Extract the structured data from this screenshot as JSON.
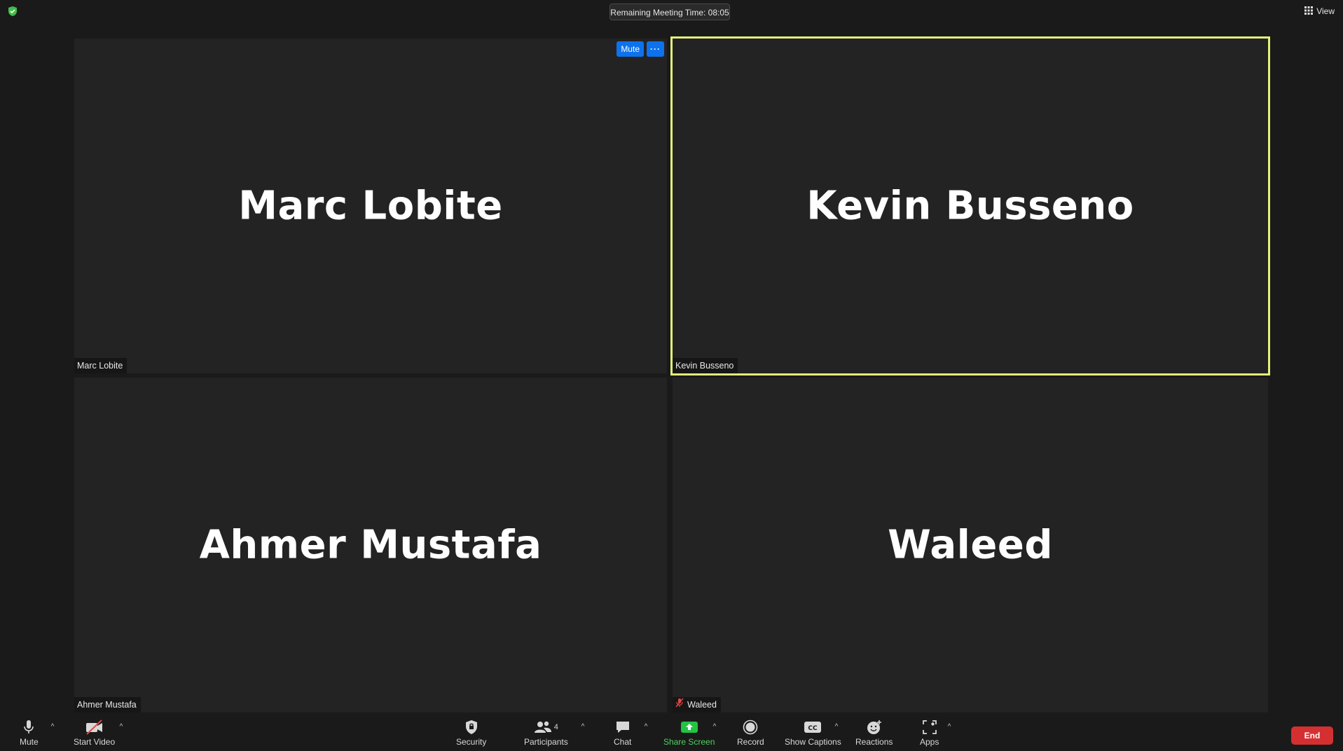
{
  "topbar": {
    "timer_text": "Remaining Meeting Time: 08:05",
    "view_label": "View",
    "shield_color": "#3fbf4a"
  },
  "tiles": [
    {
      "big_name": "Marc Lobite",
      "label": "Marc Lobite",
      "muted": false,
      "active": false
    },
    {
      "big_name": "Kevin Busseno",
      "label": "Kevin Busseno",
      "muted": false,
      "active": true
    },
    {
      "big_name": "Ahmer Mustafa",
      "label": "Ahmer Mustafa",
      "muted": false,
      "active": false
    },
    {
      "big_name": "Waleed",
      "label": "Waleed",
      "muted": true,
      "active": false
    }
  ],
  "tile_actions": {
    "mute_label": "Mute",
    "more_label": "···"
  },
  "toolbar": {
    "mute_label": "Mute",
    "start_video_label": "Start Video",
    "security_label": "Security",
    "participants_label": "Participants",
    "participants_count": "4",
    "chat_label": "Chat",
    "share_screen_label": "Share Screen",
    "record_label": "Record",
    "show_captions_label": "Show Captions",
    "reactions_label": "Reactions",
    "apps_label": "Apps",
    "end_label": "End"
  },
  "colors": {
    "active_speaker_border": "#e5f07a",
    "share_green": "#4fd15f",
    "end_red": "#d43032",
    "accent_blue": "#0e72ed"
  }
}
